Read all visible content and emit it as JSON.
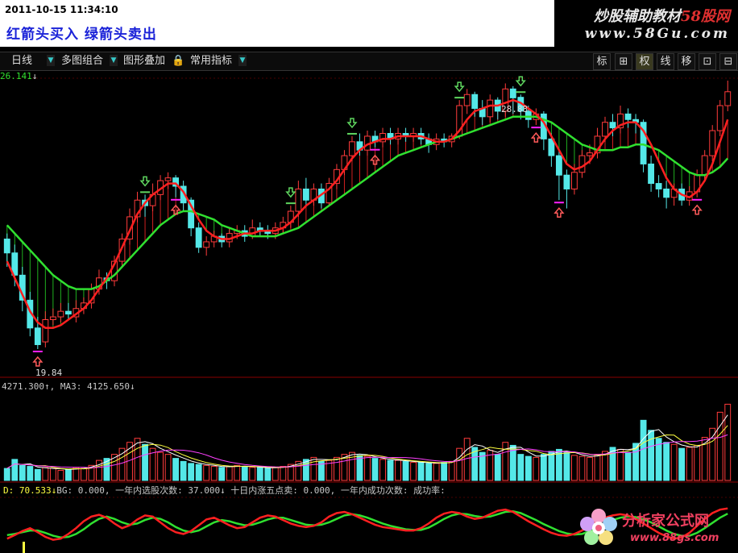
{
  "header": {
    "timestamp": "2011-10-15 11:34:10",
    "message": "红箭头买入  绿箭头卖出",
    "logo_main": "炒股辅助教材",
    "logo_accent": "58股网",
    "logo_url": "www.58Gu.com"
  },
  "toolbar": {
    "items": [
      "日线",
      "多图组合",
      "图形叠加",
      "常用指标"
    ],
    "right_buttons": [
      "标",
      "⊞",
      "权",
      "线",
      "移",
      "⊡",
      "⊟"
    ]
  },
  "main_panel": {
    "top_label": "26.141",
    "high_label": "28.88",
    "low_label": "19.84"
  },
  "volume_panel": {
    "label": "4271.300↑, MA3: 4125.650↓"
  },
  "indicator_panel": {
    "label_d": "D: 70.533↓",
    "label_rest": "BG: 0.000, 一年内选股次数: 37.000↓  十日内涨五点卖: 0.000, 一年内成功次数: 成功率:"
  },
  "watermark": {
    "name": "分析家公式网",
    "url": "www.88gs.com"
  },
  "colors": {
    "up": "#ff3b3b",
    "down": "#54e8e8",
    "ma_fast": "#ff2020",
    "ma_slow": "#30e030",
    "buy_arrow": "#ff5a5a",
    "sell_arrow": "#5fd65f",
    "magenta": "#ff20ff",
    "grid": "#8a0000"
  },
  "chart_data": {
    "type": "candlestick",
    "y_range": [
      19.0,
      29.5
    ],
    "candles": [
      [
        23.8,
        23.3,
        24.0,
        22.8
      ],
      [
        23.3,
        22.5,
        23.6,
        22.1
      ],
      [
        22.5,
        21.6,
        22.8,
        21.2
      ],
      [
        21.6,
        20.6,
        21.9,
        20.3
      ],
      [
        20.6,
        20.0,
        21.0,
        19.84
      ],
      [
        20.1,
        20.9,
        21.2,
        19.9
      ],
      [
        20.9,
        21.0,
        21.3,
        20.7
      ],
      [
        21.0,
        21.2,
        21.5,
        20.8
      ],
      [
        21.2,
        21.1,
        21.5,
        20.9
      ],
      [
        21.0,
        21.3,
        21.6,
        20.8
      ],
      [
        21.3,
        21.5,
        21.7,
        21.1
      ],
      [
        21.5,
        22.0,
        22.2,
        21.3
      ],
      [
        22.0,
        22.4,
        22.7,
        21.8
      ],
      [
        22.4,
        22.3,
        22.6,
        22.0
      ],
      [
        22.3,
        23.0,
        23.2,
        22.1
      ],
      [
        23.0,
        23.8,
        24.0,
        22.8
      ],
      [
        23.8,
        24.6,
        24.9,
        23.6
      ],
      [
        24.6,
        25.2,
        25.5,
        24.4
      ],
      [
        25.2,
        25.0,
        25.4,
        24.6
      ],
      [
        25.0,
        25.4,
        25.8,
        24.8
      ],
      [
        25.4,
        25.9,
        26.1,
        25.2
      ],
      [
        25.9,
        26.0,
        26.2,
        25.6
      ],
      [
        26.0,
        25.7,
        26.1,
        25.3
      ],
      [
        25.7,
        25.1,
        25.9,
        24.8
      ],
      [
        25.2,
        24.2,
        25.3,
        23.9
      ],
      [
        24.2,
        23.5,
        24.4,
        23.3
      ],
      [
        23.5,
        23.7,
        23.9,
        23.2
      ],
      [
        23.7,
        23.9,
        24.1,
        23.5
      ],
      [
        23.9,
        23.7,
        24.0,
        23.5
      ],
      [
        23.7,
        24.0,
        24.2,
        23.5
      ],
      [
        24.0,
        24.1,
        24.3,
        23.8
      ],
      [
        24.1,
        23.9,
        24.3,
        23.7
      ],
      [
        23.9,
        24.2,
        24.5,
        23.8
      ],
      [
        24.2,
        24.1,
        24.4,
        23.9
      ],
      [
        24.1,
        24.0,
        24.3,
        23.8
      ],
      [
        24.0,
        24.2,
        24.4,
        23.8
      ],
      [
        24.2,
        24.4,
        24.6,
        24.0
      ],
      [
        24.4,
        24.8,
        25.0,
        24.2
      ],
      [
        24.8,
        25.6,
        25.9,
        24.6
      ],
      [
        25.6,
        25.2,
        26.0,
        25.0
      ],
      [
        25.2,
        25.6,
        25.8,
        25.0
      ],
      [
        25.6,
        25.1,
        25.8,
        24.9
      ],
      [
        25.1,
        25.8,
        26.0,
        25.0
      ],
      [
        25.8,
        26.3,
        26.5,
        25.6
      ],
      [
        26.3,
        26.8,
        27.0,
        26.1
      ],
      [
        26.8,
        27.3,
        27.5,
        26.6
      ],
      [
        27.3,
        27.0,
        27.6,
        26.8
      ],
      [
        27.0,
        27.5,
        27.7,
        26.8
      ],
      [
        27.5,
        27.3,
        27.7,
        27.1
      ],
      [
        27.3,
        27.6,
        27.8,
        27.1
      ],
      [
        27.6,
        27.4,
        27.8,
        27.2
      ],
      [
        27.4,
        27.6,
        27.8,
        27.2
      ],
      [
        27.6,
        27.5,
        27.8,
        27.3
      ],
      [
        27.5,
        27.6,
        27.8,
        27.3
      ],
      [
        27.6,
        27.4,
        27.8,
        27.2
      ],
      [
        27.4,
        27.2,
        27.6,
        26.9
      ],
      [
        27.2,
        27.4,
        27.6,
        27.0
      ],
      [
        27.4,
        27.3,
        27.6,
        27.1
      ],
      [
        27.3,
        27.5,
        27.6,
        27.1
      ],
      [
        27.5,
        28.6,
        28.8,
        27.4
      ],
      [
        28.6,
        29.0,
        29.2,
        28.3
      ],
      [
        29.0,
        28.5,
        29.1,
        28.2
      ],
      [
        28.5,
        28.2,
        28.8,
        27.9
      ],
      [
        28.2,
        28.8,
        29.0,
        28.0
      ],
      [
        28.8,
        28.4,
        28.9,
        28.1
      ],
      [
        28.4,
        29.2,
        29.4,
        28.2
      ],
      [
        29.2,
        28.88,
        29.3,
        28.3
      ],
      [
        28.9,
        28.4,
        29.0,
        28.1
      ],
      [
        28.4,
        28.1,
        28.6,
        27.8
      ],
      [
        28.1,
        28.3,
        28.5,
        27.9
      ],
      [
        28.3,
        27.4,
        28.4,
        27.0
      ],
      [
        27.4,
        26.8,
        27.6,
        26.4
      ],
      [
        26.8,
        26.1,
        27.0,
        25.2
      ],
      [
        26.1,
        25.6,
        26.3,
        24.9
      ],
      [
        25.6,
        26.2,
        26.5,
        25.4
      ],
      [
        26.2,
        26.8,
        27.0,
        26.0
      ],
      [
        26.8,
        26.9,
        27.2,
        26.5
      ],
      [
        26.9,
        27.5,
        27.8,
        26.7
      ],
      [
        27.5,
        28.0,
        28.2,
        27.3
      ],
      [
        28.0,
        27.8,
        28.3,
        27.5
      ],
      [
        27.8,
        28.3,
        28.6,
        27.6
      ],
      [
        28.3,
        28.1,
        28.5,
        27.8
      ],
      [
        28.1,
        28.0,
        28.3,
        27.6
      ],
      [
        28.0,
        26.5,
        28.1,
        26.2
      ],
      [
        26.5,
        25.8,
        26.8,
        25.5
      ],
      [
        25.8,
        25.6,
        26.1,
        25.3
      ],
      [
        25.6,
        25.3,
        25.9,
        24.9
      ],
      [
        25.3,
        25.6,
        25.8,
        25.0
      ],
      [
        25.6,
        25.2,
        25.8,
        25.0
      ],
      [
        25.2,
        25.5,
        25.7,
        25.0
      ],
      [
        25.5,
        26.1,
        26.3,
        25.3
      ],
      [
        26.1,
        26.8,
        27.0,
        25.9
      ],
      [
        26.8,
        27.7,
        27.9,
        26.6
      ],
      [
        27.7,
        28.6,
        28.8,
        27.5
      ],
      [
        28.6,
        29.1,
        29.5,
        28.4
      ]
    ],
    "ma_fast": [
      23.0,
      22.4,
      21.8,
      21.2,
      20.8,
      20.6,
      20.6,
      20.7,
      20.9,
      21.1,
      21.3,
      21.6,
      22.0,
      22.4,
      22.9,
      23.5,
      24.1,
      24.7,
      25.1,
      25.4,
      25.6,
      25.8,
      25.8,
      25.5,
      25.0,
      24.5,
      24.1,
      23.9,
      23.8,
      23.8,
      23.9,
      24.0,
      24.0,
      24.1,
      24.1,
      24.1,
      24.2,
      24.4,
      24.7,
      25.0,
      25.2,
      25.4,
      25.6,
      25.9,
      26.3,
      26.7,
      27.0,
      27.2,
      27.3,
      27.4,
      27.4,
      27.5,
      27.5,
      27.5,
      27.5,
      27.4,
      27.3,
      27.3,
      27.4,
      27.7,
      28.1,
      28.4,
      28.5,
      28.6,
      28.6,
      28.7,
      28.8,
      28.7,
      28.5,
      28.3,
      28.0,
      27.5,
      27.0,
      26.5,
      26.3,
      26.4,
      26.6,
      27.0,
      27.4,
      27.7,
      27.9,
      28.0,
      28.0,
      27.7,
      27.2,
      26.6,
      26.0,
      25.6,
      25.4,
      25.3,
      25.5,
      25.9,
      26.5,
      27.3,
      28.1
    ],
    "ma_slow": [
      24.3,
      24.0,
      23.7,
      23.4,
      23.1,
      22.8,
      22.5,
      22.3,
      22.1,
      22.0,
      22.0,
      22.0,
      22.1,
      22.3,
      22.5,
      22.8,
      23.1,
      23.4,
      23.7,
      24.0,
      24.3,
      24.5,
      24.7,
      24.8,
      24.8,
      24.7,
      24.6,
      24.5,
      24.3,
      24.2,
      24.1,
      24.0,
      23.9,
      23.9,
      23.9,
      23.9,
      24.0,
      24.1,
      24.2,
      24.4,
      24.6,
      24.8,
      25.0,
      25.2,
      25.4,
      25.6,
      25.8,
      26.0,
      26.2,
      26.4,
      26.6,
      26.8,
      26.9,
      27.0,
      27.1,
      27.2,
      27.3,
      27.3,
      27.4,
      27.5,
      27.6,
      27.7,
      27.8,
      27.9,
      28.0,
      28.1,
      28.2,
      28.2,
      28.2,
      28.2,
      28.1,
      28.0,
      27.8,
      27.6,
      27.4,
      27.2,
      27.1,
      27.0,
      27.0,
      27.0,
      27.1,
      27.1,
      27.2,
      27.2,
      27.1,
      27.0,
      26.8,
      26.6,
      26.4,
      26.2,
      26.1,
      26.1,
      26.2,
      26.4,
      26.7
    ],
    "buy_signals": [
      4,
      22,
      48,
      69,
      72,
      90
    ],
    "sell_signals": [
      18,
      37,
      45,
      59,
      67
    ],
    "volume_range": [
      0,
      9000
    ],
    "volume": [
      1200,
      2100,
      1500,
      1400,
      1100,
      1300,
      1200,
      1000,
      1100,
      1300,
      1200,
      1500,
      2000,
      2200,
      2600,
      3200,
      3800,
      4200,
      3600,
      3200,
      2800,
      2600,
      2200,
      1900,
      1700,
      1600,
      1500,
      1400,
      1300,
      1400,
      1500,
      1400,
      1300,
      1300,
      1200,
      1300,
      1400,
      1600,
      1900,
      2100,
      2300,
      1900,
      2000,
      2300,
      2600,
      2800,
      2500,
      2400,
      2200,
      2100,
      2000,
      2000,
      1900,
      1800,
      1800,
      1700,
      1700,
      1800,
      1900,
      3200,
      4200,
      3300,
      2800,
      3000,
      2600,
      3800,
      3500,
      2600,
      2400,
      2300,
      2600,
      2900,
      3100,
      2800,
      2500,
      2400,
      2300,
      2600,
      2900,
      3300,
      3100,
      2800,
      3700,
      6000,
      5000,
      4200,
      3800,
      3600,
      3200,
      3300,
      3500,
      4300,
      5200,
      6800,
      7600
    ],
    "kd_k": [
      22,
      28,
      35,
      40,
      33,
      25,
      20,
      22,
      30,
      40,
      52,
      60,
      63,
      58,
      48,
      40,
      45,
      55,
      62,
      60,
      50,
      40,
      33,
      30,
      35,
      45,
      55,
      58,
      52,
      45,
      40,
      42,
      50,
      58,
      62,
      60,
      54,
      48,
      44,
      42,
      44,
      50,
      60,
      66,
      68,
      64,
      58,
      52,
      46,
      42,
      40,
      38,
      36,
      36,
      40,
      48,
      58,
      65,
      68,
      66,
      60,
      56,
      58,
      64,
      70,
      72,
      68,
      60,
      52,
      45,
      38,
      32,
      28,
      27,
      30,
      36,
      44,
      52,
      58,
      62,
      64,
      62,
      56,
      48,
      40,
      32,
      26,
      22,
      24,
      32,
      44,
      56,
      66,
      72,
      74
    ],
    "kd_d": [
      28,
      30,
      33,
      36,
      36,
      32,
      27,
      24,
      25,
      30,
      38,
      48,
      56,
      60,
      56,
      50,
      46,
      48,
      54,
      58,
      56,
      50,
      42,
      36,
      33,
      36,
      43,
      50,
      54,
      52,
      48,
      45,
      46,
      50,
      55,
      58,
      58,
      54,
      50,
      46,
      45,
      46,
      50,
      56,
      62,
      64,
      62,
      58,
      53,
      48,
      44,
      41,
      38,
      37,
      37,
      41,
      48,
      56,
      62,
      65,
      64,
      61,
      59,
      60,
      64,
      68,
      69,
      66,
      60,
      54,
      47,
      41,
      35,
      31,
      29,
      30,
      35,
      41,
      48,
      54,
      58,
      60,
      59,
      55,
      50,
      43,
      36,
      30,
      27,
      27,
      32,
      40,
      49,
      58,
      65
    ]
  }
}
